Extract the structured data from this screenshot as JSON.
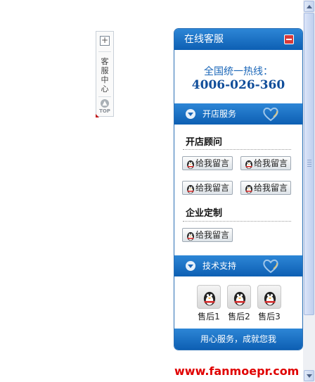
{
  "side_tab": {
    "expand_glyph": "+",
    "label_chars": [
      "客",
      "服",
      "中",
      "心"
    ],
    "top_label": "TOP"
  },
  "panel": {
    "title": "在线客服",
    "hotline_label": "全国统一热线：",
    "hotline_number": "4006-026-360",
    "sections": {
      "shop": {
        "title": "开店服务",
        "groups": [
          {
            "title": "开店顾问",
            "buttons": [
              "给我留言",
              "给我留言",
              "给我留言",
              "给我留言"
            ]
          },
          {
            "title": "企业定制",
            "buttons": [
              "给我留言"
            ]
          }
        ]
      },
      "tech": {
        "title": "技术支持",
        "agents": [
          "售后1",
          "售后2",
          "售后3"
        ]
      }
    },
    "footer": "用心服务，成就您我"
  },
  "watermark": "www.fanmoepr.com",
  "colors": {
    "brand_blue": "#1a66b8",
    "close_red": "#d83a3a",
    "watermark_red": "#e00000"
  }
}
